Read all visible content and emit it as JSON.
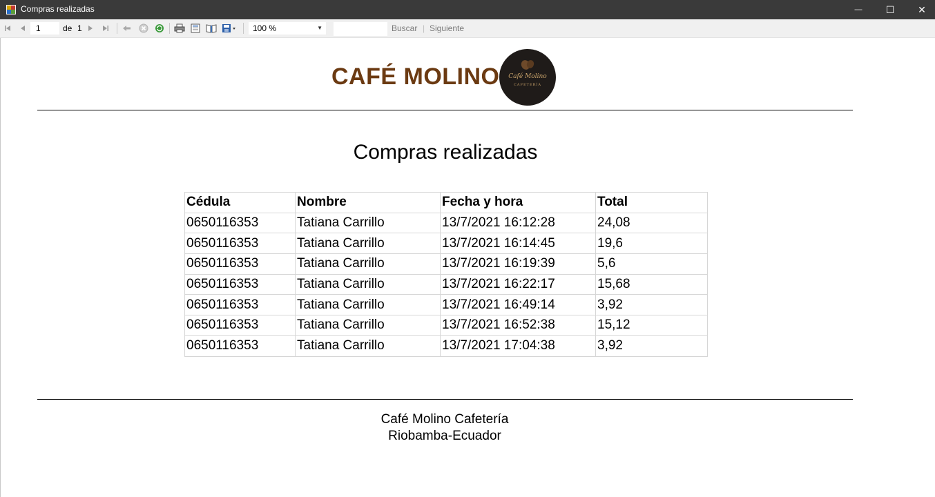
{
  "window": {
    "title": "Compras realizadas",
    "controls": {
      "minimize": "—",
      "maximize": "☐",
      "close": "✕"
    }
  },
  "toolbar": {
    "page_current": "1",
    "page_of_label": "de",
    "page_total": "1",
    "zoom": "100 %",
    "search_placeholder": "",
    "find_label": "Buscar",
    "next_label": "Siguiente",
    "icons": [
      "first-page-icon",
      "prev-page-icon",
      "next-page-icon",
      "last-page-icon",
      "back-icon",
      "stop-icon",
      "refresh-icon",
      "print-icon",
      "print-layout-icon",
      "page-setup-icon",
      "export-icon"
    ]
  },
  "report": {
    "brand": "CAFÉ MOLINO",
    "logo_text": "Café Molino",
    "logo_subtext": "CAFETERÍA",
    "title": "Compras realizadas",
    "table": {
      "headers": [
        "Cédula",
        "Nombre",
        "Fecha y hora",
        "Total"
      ],
      "rows": [
        [
          "0650116353",
          "Tatiana Carrillo",
          "13/7/2021 16:12:28",
          "24,08"
        ],
        [
          "0650116353",
          "Tatiana Carrillo",
          "13/7/2021 16:14:45",
          "19,6"
        ],
        [
          "0650116353",
          "Tatiana Carrillo",
          "13/7/2021 16:19:39",
          "5,6"
        ],
        [
          "0650116353",
          "Tatiana Carrillo",
          "13/7/2021 16:22:17",
          "15,68"
        ],
        [
          "0650116353",
          "Tatiana Carrillo",
          "13/7/2021 16:49:14",
          "3,92"
        ],
        [
          "0650116353",
          "Tatiana Carrillo",
          "13/7/2021 16:52:38",
          "15,12"
        ],
        [
          "0650116353",
          "Tatiana Carrillo",
          "13/7/2021 17:04:38",
          "3,92"
        ]
      ]
    },
    "footer_line1": "Café Molino Cafetería",
    "footer_line2": "Riobamba-Ecuador"
  },
  "colors": {
    "titlebar_bg": "#3a3a3a",
    "brand_text": "#6b3a12",
    "logo_bg": "#1f1b19",
    "logo_accent": "#c9a36b"
  }
}
